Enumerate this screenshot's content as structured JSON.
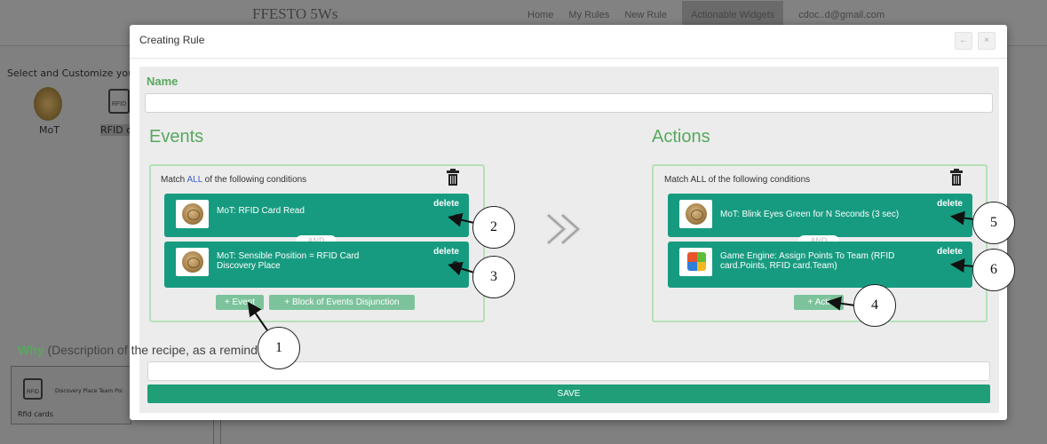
{
  "background": {
    "brand": "FFESTO 5Ws",
    "nav": [
      "Home",
      "My Rules",
      "New Rule",
      "Actionable Widgets",
      "cdoc..d@gmail.com"
    ],
    "active_nav_index": 3,
    "subtitle": "Select and Customize your S",
    "widgets": [
      {
        "label": "MoT",
        "icon": "coin-icon"
      },
      {
        "label": "RFID c",
        "icon": "rfid-card-icon"
      }
    ],
    "card": {
      "text": "Discovery Place Team Poi",
      "footer": "Rfid cards",
      "icon": "rfid-card-icon"
    }
  },
  "modal": {
    "title": "Creating Rule",
    "header_buttons": [
      {
        "name": "back-button",
        "glyph": "←"
      },
      {
        "name": "close-button",
        "glyph": "×"
      }
    ],
    "name_label": "Name",
    "name_value": "",
    "events": {
      "title": "Events",
      "match_prefix": "Match ",
      "match_keyword": "ALL",
      "match_suffix": " of the following conditions",
      "conditions": [
        {
          "text": "MoT: RFID Card Read",
          "delete_label": "delete",
          "thumb": "coin-icon"
        },
        {
          "text": "MoT: Sensible Position = RFID Card Discovery Place",
          "delete_label": "delete",
          "thumb": "coin-icon"
        }
      ],
      "and_label": "AND",
      "add_event_label": "+ Event",
      "add_block_label": "+ Block of Events Disjunction"
    },
    "actions": {
      "title": "Actions",
      "match_text": "Match ALL of the following conditions",
      "conditions": [
        {
          "text": "MoT: Blink Eyes Green for N Seconds (3 sec)",
          "delete_label": "delete",
          "thumb": "coin-icon"
        },
        {
          "text": "Game Engine: Assign Points To Team (RFID card.Points, RFID card.Team)",
          "delete_label": "delete",
          "thumb": "game-engine-app-icon"
        }
      ],
      "and_label": "AND",
      "add_action_label": "+ Acti"
    },
    "why_label": "Why",
    "why_hint": " (Description of the recipe, as a reminder)",
    "why_value": "",
    "save_label": "SAVE"
  },
  "callouts": [
    "1",
    "2",
    "3",
    "4",
    "5",
    "6"
  ],
  "colors": {
    "accent_green": "#57a85e",
    "condition_teal": "#179b80",
    "panel_border": "#b6e0b8",
    "save_green": "#1f9e78",
    "light_button": "#7cc39c",
    "all_keyword_blue": "#3c5fc7"
  }
}
